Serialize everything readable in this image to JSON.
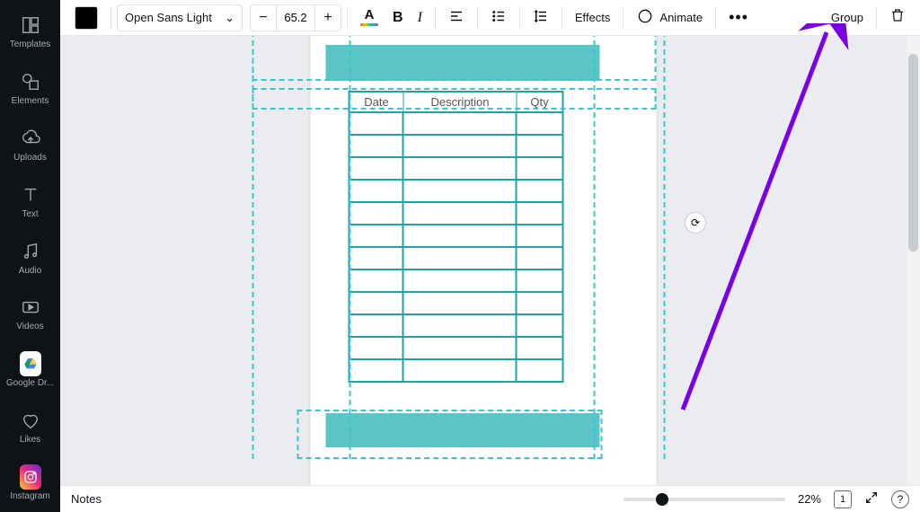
{
  "sidebar": {
    "items": [
      {
        "label": "Templates"
      },
      {
        "label": "Elements"
      },
      {
        "label": "Uploads"
      },
      {
        "label": "Text"
      },
      {
        "label": "Audio"
      },
      {
        "label": "Videos"
      },
      {
        "label": "Google Dr..."
      },
      {
        "label": "Likes"
      },
      {
        "label": "Instagram"
      }
    ]
  },
  "toolbar": {
    "font_name": "Open Sans Light",
    "font_size": "65.2",
    "effects_label": "Effects",
    "animate_label": "Animate",
    "group_label": "Group"
  },
  "canvas": {
    "table": {
      "headers": {
        "date": "Date",
        "desc": "Description",
        "qty": "Qty"
      },
      "row_count": 12
    }
  },
  "bottombar": {
    "notes_label": "Notes",
    "zoom_label": "22%",
    "page_num": "1",
    "help": "?"
  }
}
